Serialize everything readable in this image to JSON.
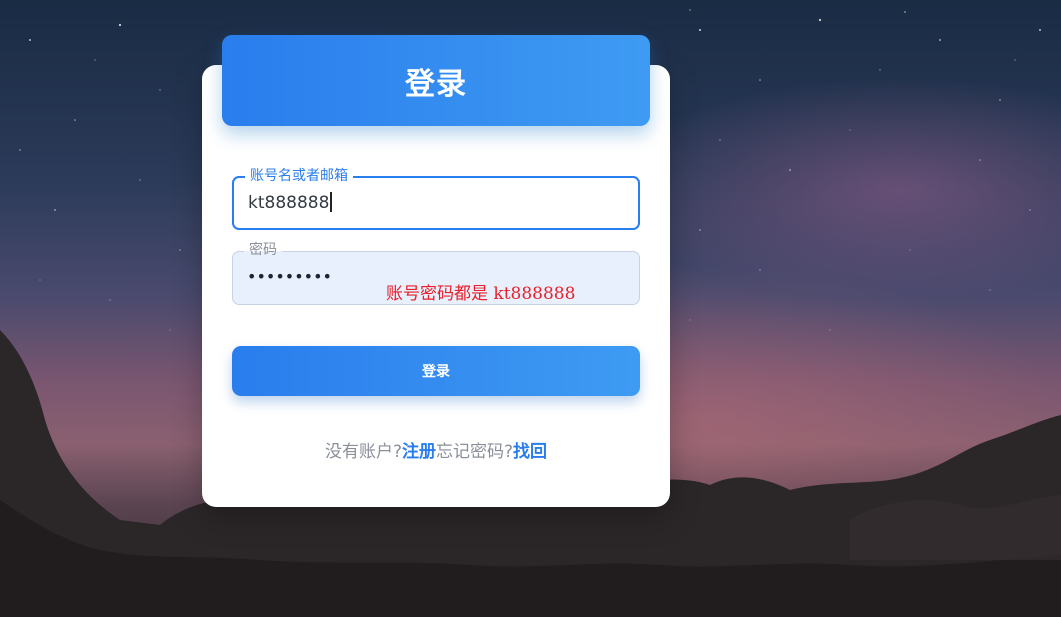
{
  "page": {
    "header_title": "登录"
  },
  "form": {
    "username": {
      "label": "账号名或者邮箱",
      "value": "kt888888"
    },
    "password": {
      "label": "密码",
      "masked_value": "•••••••••"
    },
    "hint": "账号密码都是  kt888888",
    "submit_label": "登录"
  },
  "footer": {
    "no_account_text": "没有账户?",
    "register_link": "注册",
    "forgot_text": "忘记密码?",
    "recover_link": "找回"
  },
  "colors": {
    "accent": "#2a7ded",
    "hint": "#e8202a",
    "muted": "#8a8f99"
  }
}
